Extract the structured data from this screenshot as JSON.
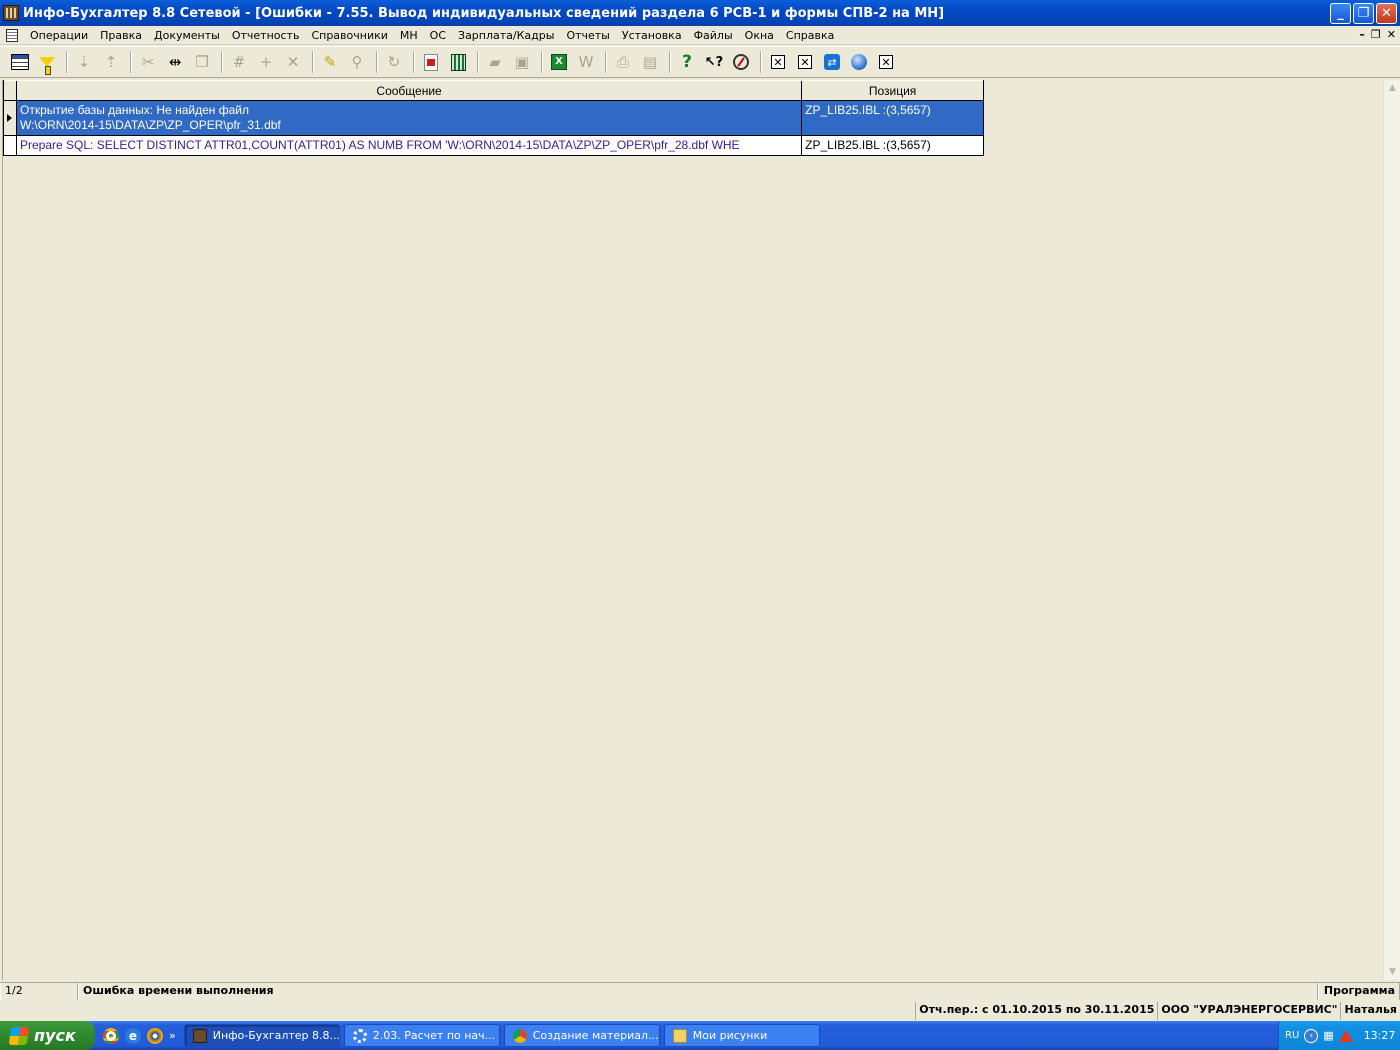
{
  "window": {
    "title": "Инфо-Бухгалтер 8.8 Сетевой - [Ошибки - 7.55. Вывод индивидуальных сведений раздела 6 РСВ-1 и формы СПВ-2 на МН]",
    "minimize": "_",
    "restore": "❐",
    "close": "✕"
  },
  "menu": {
    "items": [
      "Операции",
      "Правка",
      "Документы",
      "Отчетность",
      "Справочники",
      "МН",
      "ОС",
      "Зарплата/Кадры",
      "Отчеты",
      "Установка",
      "Файлы",
      "Окна",
      "Справка"
    ],
    "mdi_minimize": "–",
    "mdi_restore": "❐",
    "mdi_close": "✕"
  },
  "toolbar": {
    "icons": [
      "grid-view-icon",
      "filter-icon",
      "sort-asc-icon",
      "sort-desc-icon",
      "cut-icon",
      "column-width-icon",
      "paste-icon",
      "number-format-icon",
      "add-icon",
      "delete-icon",
      "highlight-icon",
      "find-replace-icon",
      "refresh-icon",
      "pdf-icon",
      "calculator-icon",
      "open-folder-icon",
      "save-icon",
      "excel-icon",
      "word-icon",
      "print-icon",
      "print-preview-icon",
      "help-icon",
      "context-help-icon",
      "compass-icon",
      "close-box-icon",
      "close-box-icon",
      "teamviewer-icon",
      "web-icon",
      "close-box-icon"
    ]
  },
  "grid": {
    "columns": [
      "Сообщение",
      "Позиция"
    ],
    "rows": [
      {
        "message_line1": "Открытие базы данных: Не найден файл",
        "message_line2": "W:\\ORN\\2014-15\\DATA\\ZP\\ZP_OPER\\pfr_31.dbf",
        "position": "ZP_LIB25.IBL :(3,5657)"
      },
      {
        "message_line1": "Prepare SQL: SELECT DISTINCT ATTR01,COUNT(ATTR01) AS NUMB FROM 'W:\\ORN\\2014-15\\DATA\\ZP\\ZP_OPER\\pfr_28.dbf  WHE",
        "position": "ZP_LIB25.IBL :(3,5657)"
      }
    ]
  },
  "status": {
    "record": "1/2",
    "error_type": "Ошибка времени выполнения",
    "source": "Программа"
  },
  "info": {
    "period": "Отч.пер.: с 01.10.2015 по 30.11.2015",
    "company": "ООО \"УРАЛЭНЕРГОСЕРВИС\"",
    "user": "Наталья"
  },
  "taskbar": {
    "start_label": "пуск",
    "more": "»",
    "tasks": [
      "Инфо-Бухгалтер 8.8...",
      "2.03. Расчет по нач...",
      "Создание материал...",
      "Мои рисунки"
    ],
    "lang": "RU",
    "clock": "13:27"
  }
}
